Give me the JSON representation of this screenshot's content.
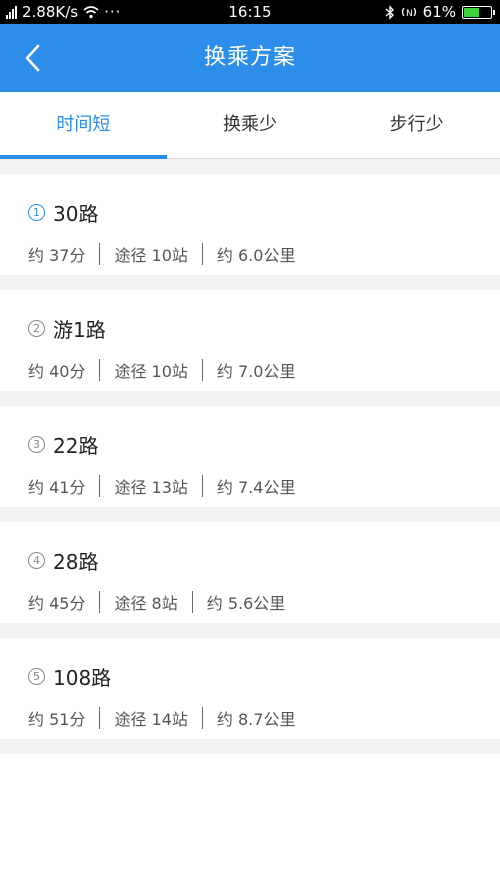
{
  "status_bar": {
    "network": "2.88K/s",
    "more": "···",
    "time": "16:15",
    "battery": "61%",
    "icons": [
      "signal-icon",
      "wifi-icon",
      "bluetooth-icon",
      "nfc-icon",
      "battery-icon"
    ],
    "battery_level": 0.61
  },
  "header": {
    "title": "换乘方案",
    "back_icon": "chevron-left-icon",
    "bg_color": "#2c8ee8"
  },
  "tabs": [
    {
      "label": "时间短",
      "active": true
    },
    {
      "label": "换乘少",
      "active": false
    },
    {
      "label": "步行少",
      "active": false
    }
  ],
  "routes": [
    {
      "index": "1",
      "name": "30路",
      "time": "约 37分",
      "stops": "途径 10站",
      "distance": "约 6.0公里"
    },
    {
      "index": "2",
      "name": "游1路",
      "time": "约 40分",
      "stops": "途径 10站",
      "distance": "约 7.0公里"
    },
    {
      "index": "3",
      "name": "22路",
      "time": "约 41分",
      "stops": "途径 13站",
      "distance": "约 7.4公里"
    },
    {
      "index": "4",
      "name": "28路",
      "time": "约 45分",
      "stops": "途径 8站",
      "distance": "约 5.6公里"
    },
    {
      "index": "5",
      "name": "108路",
      "time": "约 51分",
      "stops": "途径 14站",
      "distance": "约 8.7公里"
    }
  ]
}
